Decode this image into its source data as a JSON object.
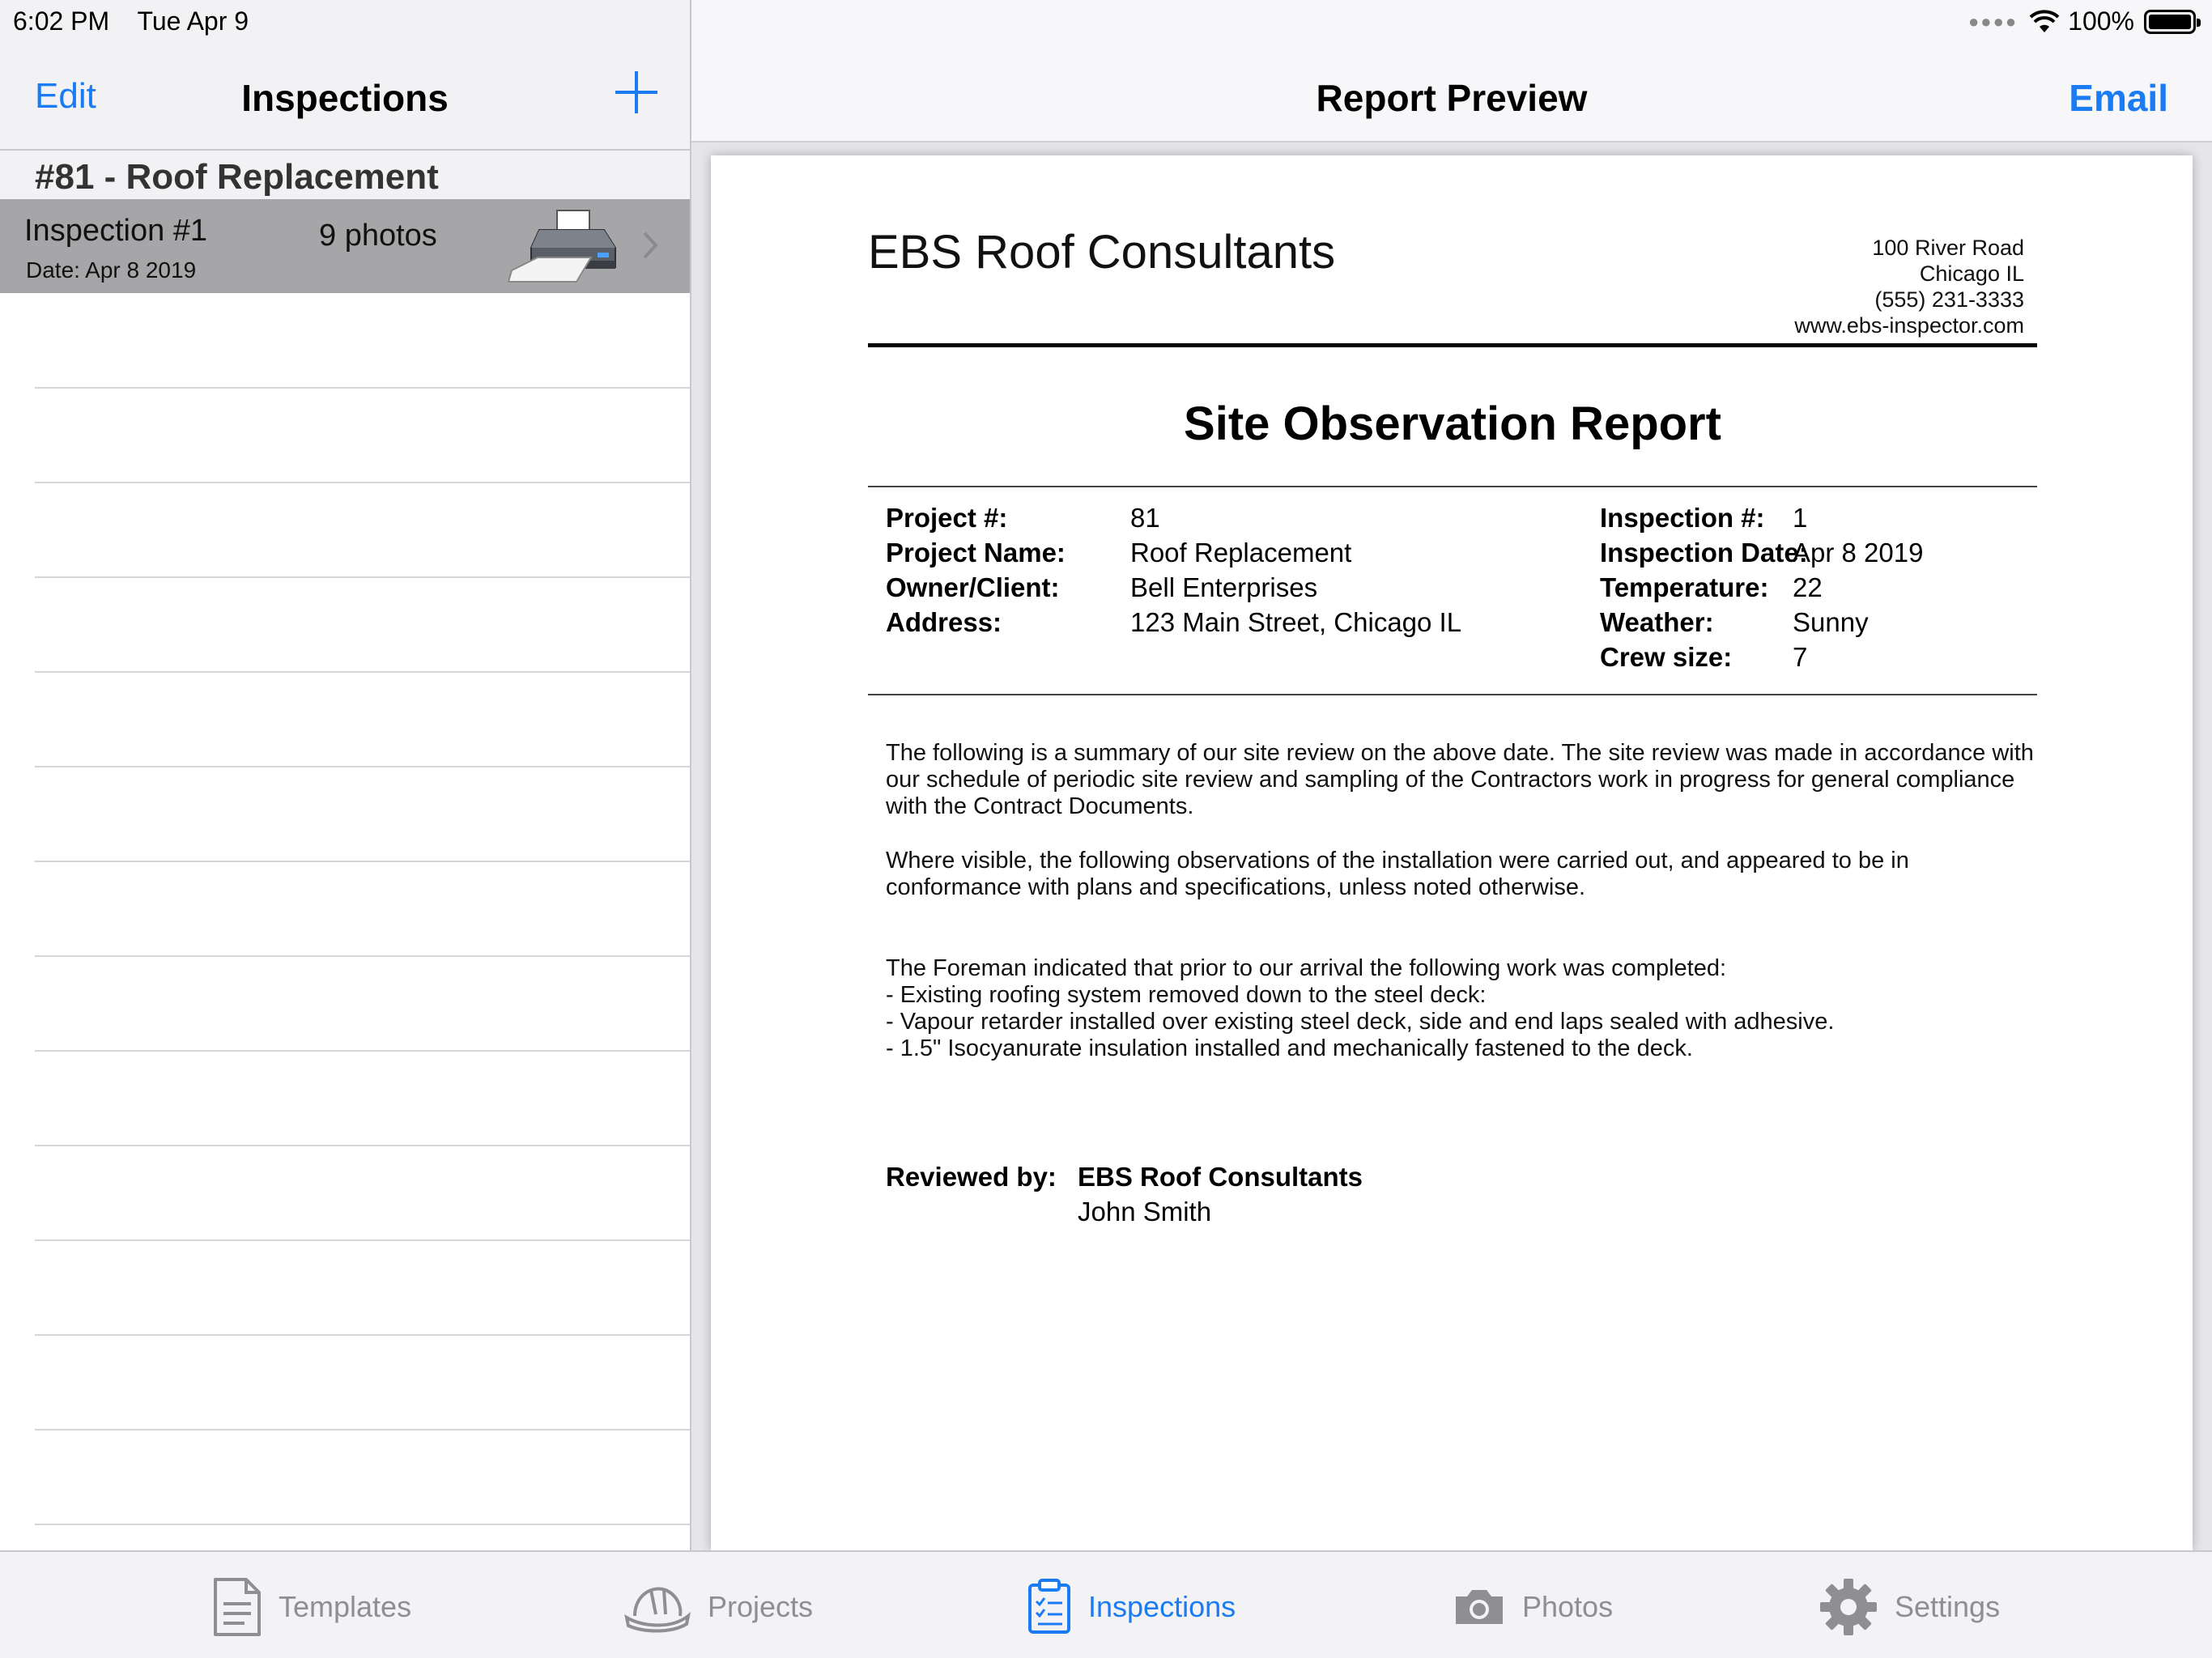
{
  "status_bar": {
    "time": "6:02 PM",
    "date": "Tue Apr 9",
    "battery": "100%"
  },
  "master": {
    "edit_label": "Edit",
    "title": "Inspections",
    "section_title": "#81 - Roof Replacement",
    "rows": [
      {
        "title": "Inspection #1",
        "date": "Date: Apr 8 2019",
        "photos": "9 photos"
      }
    ]
  },
  "detail": {
    "title": "Report Preview",
    "email_label": "Email"
  },
  "report": {
    "company": "EBS Roof Consultants",
    "address_lines": [
      "100 River Road",
      "Chicago IL",
      "(555) 231-3333",
      "www.ebs-inspector.com"
    ],
    "title": "Site Observation Report",
    "left_fields": [
      {
        "label": "Project #:",
        "value": "81"
      },
      {
        "label": "Project Name:",
        "value": "Roof Replacement"
      },
      {
        "label": "Owner/Client:",
        "value": "Bell Enterprises"
      },
      {
        "label": "Address:",
        "value": "123 Main Street, Chicago IL"
      }
    ],
    "right_fields": [
      {
        "label": "Inspection #:",
        "value": "1"
      },
      {
        "label": "Inspection Date:",
        "value": "Apr 8 2019"
      },
      {
        "label": "Temperature:",
        "value": "22"
      },
      {
        "label": "Weather:",
        "value": "Sunny"
      },
      {
        "label": "Crew size:",
        "value": "7"
      }
    ],
    "paragraph1": "The following is a summary of our site review on the above date. The site review was made in accordance with our schedule of periodic site review and sampling of the Contractors work in progress for general compliance with the Contract Documents.",
    "paragraph2": "Where visible, the following observations of the installation were carried out, and appeared to be in conformance with plans and specifications, unless noted otherwise.",
    "paragraph3": "The Foreman indicated that prior to our arrival the following work was completed:\n - Existing roofing system removed down to the steel deck:\n - Vapour retarder installed over existing steel deck, side and end laps sealed with adhesive.\n - 1.5\" Isocyanurate insulation installed and mechanically fastened to the deck.",
    "reviewed_label": "Reviewed by:",
    "reviewed_org": "EBS Roof Consultants",
    "reviewed_name": "John Smith"
  },
  "tabs": [
    {
      "label": "Templates",
      "icon": "document-icon",
      "active": false
    },
    {
      "label": "Projects",
      "icon": "hardhat-icon",
      "active": false
    },
    {
      "label": "Inspections",
      "icon": "clipboard-icon",
      "active": true
    },
    {
      "label": "Photos",
      "icon": "camera-icon",
      "active": false
    },
    {
      "label": "Settings",
      "icon": "gear-icon",
      "active": false
    }
  ],
  "colors": {
    "accent": "#1a7bf2",
    "inactive_tab": "#8e8e93",
    "selected_row": "#a6a6a9"
  }
}
